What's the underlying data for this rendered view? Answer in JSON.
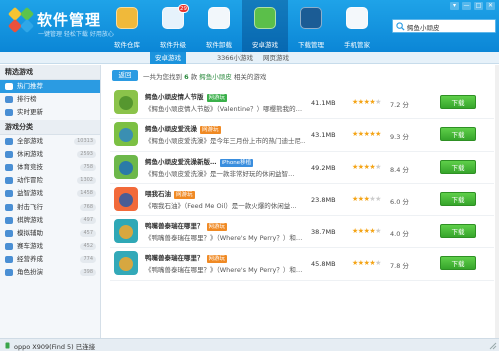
{
  "app": {
    "title": "软件管理",
    "subtitle": "一键管理 轻松下载 好用放心"
  },
  "window_buttons": [
    "▾",
    "—",
    "□",
    "✕"
  ],
  "nav_tabs": [
    {
      "label": "软件仓库",
      "icon": "disc-icon",
      "color": "#f0b93a",
      "active": false
    },
    {
      "label": "软件升级",
      "icon": "upgrade-icon",
      "color": "#e6f2fb",
      "active": false,
      "badge": "29"
    },
    {
      "label": "软件卸载",
      "icon": "trash-icon",
      "color": "#f2f7fb",
      "active": false
    },
    {
      "label": "安卓游戏",
      "icon": "android-icon",
      "color": "#5bbf4a",
      "active": true
    },
    {
      "label": "下载管理",
      "icon": "download-icon",
      "color": "#1b5c95",
      "active": false
    },
    {
      "label": "手机管家",
      "icon": "shield-icon",
      "color": "#f4f8fb",
      "active": false
    }
  ],
  "search": {
    "value": "鳄鱼小顽皮"
  },
  "subnav": [
    {
      "label": "安卓游戏"
    },
    {
      "label": "3366小游戏"
    },
    {
      "label": "网页游戏"
    }
  ],
  "sidebar": {
    "section1_title": "精选游戏",
    "section1": [
      {
        "label": "热门推荐",
        "icon": "fire-icon",
        "color": "#ffffff",
        "active": true
      },
      {
        "label": "排行榜",
        "icon": "chart-icon",
        "color": "#4a8fd4"
      },
      {
        "label": "实时更新",
        "icon": "clock-icon",
        "color": "#4a8fd4"
      }
    ],
    "section2_title": "游戏分类",
    "section2": [
      {
        "label": "全部游戏",
        "count": "10313",
        "icon": "grid-icon",
        "color": "#4a8fd4"
      },
      {
        "label": "休闲游戏",
        "count": "2593",
        "icon": "smile-icon",
        "color": "#4a8fd4"
      },
      {
        "label": "体育竞技",
        "count": "758",
        "icon": "ball-icon",
        "color": "#4a8fd4"
      },
      {
        "label": "动作冒险",
        "count": "1302",
        "icon": "sword-icon",
        "color": "#4a8fd4"
      },
      {
        "label": "益智游戏",
        "count": "1458",
        "icon": "puzzle-icon",
        "color": "#4a8fd4"
      },
      {
        "label": "射击飞行",
        "count": "768",
        "icon": "plane-icon",
        "color": "#4a8fd4"
      },
      {
        "label": "棋牌游戏",
        "count": "497",
        "icon": "cards-icon",
        "color": "#4a8fd4"
      },
      {
        "label": "模拟辅助",
        "count": "457",
        "icon": "tool-icon",
        "color": "#4a8fd4"
      },
      {
        "label": "赛车游戏",
        "count": "452",
        "icon": "car-icon",
        "color": "#4a8fd4"
      },
      {
        "label": "经营养成",
        "count": "774",
        "icon": "house-icon",
        "color": "#4a8fd4"
      },
      {
        "label": "角色扮演",
        "count": "398",
        "icon": "mask-icon",
        "color": "#4a8fd4"
      }
    ]
  },
  "main": {
    "back_label": "返回",
    "result_prefix": "一共为您找到",
    "result_count": "6",
    "result_mid": "款",
    "result_keyword": "鳄鱼小顽皮",
    "result_suffix": "相关的游戏",
    "download_label": "下载",
    "apps": [
      {
        "title": "鳄鱼小顽皮情人节版",
        "tag": "网游玩",
        "tag_color": "#3ab04a",
        "desc": "《鳄鱼小顽皮情人节版》（Valentine？）哪樱熊我的…",
        "size": "41.1MB",
        "rating": 4,
        "score": "7.2 分",
        "icon_color": "#8bc34a",
        "icon_accent": "#4c8f2a"
      },
      {
        "title": "鳄鱼小顽皮爱洗澡",
        "tag": "网游玩",
        "tag_color": "#f08a24",
        "desc": "《鳄鱼小顽皮爱洗澡》是今年三月份上市的热门迪士尼…",
        "size": "43.1MB",
        "rating": 4.5,
        "score": "9.3 分",
        "icon_color": "#7cc043",
        "icon_accent": "#2f86c6"
      },
      {
        "title": "鳄鱼小顽皮爱洗澡新版…",
        "tag": "iPhone移植",
        "tag_color": "#3a8ede",
        "desc": "《鳄鱼小顽皮爱洗澡》是一款非常好玩的休闲益智…",
        "size": "49.2MB",
        "rating": 4,
        "score": "8.4 分",
        "icon_color": "#6db84a",
        "icon_accent": "#1e6fb8"
      },
      {
        "title": "喂我石油",
        "tag": "网游玩",
        "tag_color": "#f08a24",
        "desc": "《喂我石油》（Feed Me Oil）是一款火爆的休闲益…",
        "size": "23.8MB",
        "rating": 3,
        "score": "6.0 分",
        "icon_color": "#f26a3a",
        "icon_accent": "#2b5aa6"
      },
      {
        "title": "鸭嘴兽泰瑞在哪里？",
        "tag": "网游玩",
        "tag_color": "#f08a24",
        "desc": "《鸭嘴兽泰瑞在哪里？》（Where's My Perry？）和…",
        "size": "38.7MB",
        "rating": 4,
        "score": "4.0 分",
        "icon_color": "#2fa8b6",
        "icon_accent": "#f4a72a"
      },
      {
        "title": "鸭嘴兽泰瑞在哪里？",
        "tag": "网游玩",
        "tag_color": "#f08a24",
        "desc": "《鸭嘴兽泰瑞在哪里？》（Where's My Perry？）和…",
        "size": "45.8MB",
        "rating": 4,
        "score": "7.8 分",
        "icon_color": "#33a9b8",
        "icon_accent": "#f4a72a"
      }
    ]
  },
  "status": {
    "text": "oppo X909(Find 5) 已连接"
  }
}
